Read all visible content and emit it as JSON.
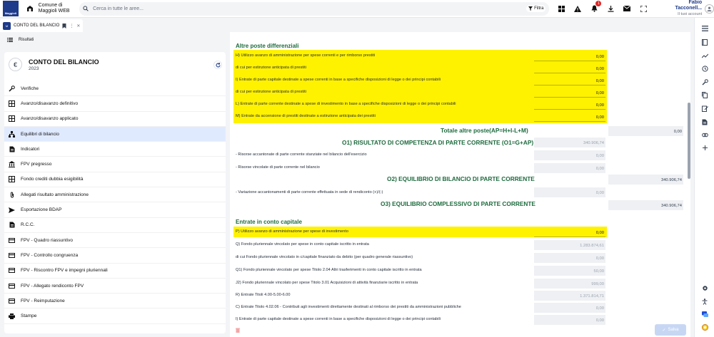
{
  "app": {
    "logo_text": "Maggioli",
    "brand_line1": "Comune di",
    "brand_line2": "Maggioli WEB",
    "search_placeholder": "Cerca in tutte le aree...",
    "filter_label": "Filtra",
    "notifications_count": "1",
    "user_name": "Fabio Tacconell...",
    "user_sub": "Il tuoi account"
  },
  "tab": {
    "icon_text": "M",
    "label": "CONTO DEL BILANCIO"
  },
  "results_label": "Risultati",
  "sidebar": {
    "title": "CONTO DEL BILANCIO",
    "year": "2023",
    "items": [
      {
        "label": "Verifiche",
        "icon": "wrench-icon"
      },
      {
        "label": "Avanzo/disavanzo definitivo",
        "icon": "grid-icon"
      },
      {
        "label": "Avanzo/disavanzo applicato",
        "icon": "grid-icon"
      },
      {
        "label": "Equilibri di bilancio",
        "icon": "sitemap-icon"
      },
      {
        "label": "Indicatori",
        "icon": "document-icon"
      },
      {
        "label": "FPV pregresso",
        "icon": "bank-icon"
      },
      {
        "label": "Fondo crediti dubbia esigibilità",
        "icon": "grid-icon"
      },
      {
        "label": "Allegati risultato amministrazione",
        "icon": "paperclip-icon"
      },
      {
        "label": "Esportazione BDAP",
        "icon": "send-icon"
      },
      {
        "label": "R.C.C.",
        "icon": "document-icon"
      },
      {
        "label": "FPV - Quadro riassuntivo",
        "icon": "card-icon"
      },
      {
        "label": "FPV - Controllo congruenza",
        "icon": "card-icon"
      },
      {
        "label": "FPV - Riscontro FPV e impegni pluriennali",
        "icon": "card-icon"
      },
      {
        "label": "FPV - Allegato rendiconto FPV",
        "icon": "card-icon"
      },
      {
        "label": "FPV - Reimputazione",
        "icon": "card-icon"
      },
      {
        "label": "Stampe",
        "icon": "printer-icon"
      }
    ]
  },
  "main": {
    "section1_title": "Altre poste differenziali",
    "rows1": [
      {
        "label": "H) Utilizzo avanzo di amministrazione per spese correnti e per rimborso prestiti",
        "value": "0,00"
      },
      {
        "label": "di cui per estinzione anticipata di prestiti",
        "value": "0,00"
      },
      {
        "label": "I) Entrate di parte capitale destinate a spese correnti in base a specifiche disposizioni di legge o dei principi contabili",
        "value": "0,00"
      },
      {
        "label": "di cui per estinzione anticipata di prestiti",
        "value": "0,00"
      },
      {
        "label": "L) Entrate di parte corrente destinate a spese di investimento in base a specifiche disposizioni di legge o dei principi contabili",
        "value": "0,00"
      },
      {
        "label": "M) Entrate da accensione di prestiti destinate a estinzione anticipata dei prestiti",
        "value": "0,00"
      }
    ],
    "total_label": "Totale altre poste(AP=H+I-L+M)",
    "total_value": "0,00",
    "o1_label": "O1) RISULTATO DI COMPETENZA DI PARTE CORRENTE (O1=G+AP)",
    "o1_value": "340.906,74",
    "o1_rows": [
      {
        "label": "- Risorse accantonate di parte corrente stanziate nel bilancio dell'esercizio",
        "value": "0,00"
      },
      {
        "label": "- Risorse vincolate di parte corrente nel bilancio",
        "value": "0,00"
      }
    ],
    "o2_label": "O2) EQUILIBRIO DI BILANCIO DI PARTE CORRENTE",
    "o2_value": "340.906,74",
    "o2_row": {
      "label": "- Variazione accantonamenti di parte corrente effettuata in sede di rendiconto (+)/(-)",
      "value": "0,00"
    },
    "o3_label": "O3) EQUILIBRIO COMPLESSIVO DI PARTE CORRENTE",
    "o3_value": "340.906,74",
    "section2_title": "Entrate in conto capitale",
    "p_row": {
      "label": "P) Utilizzo avanzo di amministrazione per spese di investimento",
      "value": "0,00"
    },
    "rows2": [
      {
        "label": "Q) Fondo pluriennale vincolato per spese in conto capitale iscritto in entrata",
        "value": "1.283.874,61"
      },
      {
        "label": "di cui Fondo pluriennale vincolato in c/capitale finanziato da debito (per quadro generale riassuntivo)",
        "value": "0,00"
      },
      {
        "label": "Q1) Fondo pluriennale vincolato per spese Titolo 2.04 Altri trasferimenti in conto capitale iscritto in entrata",
        "value": "50,00"
      },
      {
        "label": "J2) Fondo pluriennale vincolato per spese Titolo 3.01 Acquisizioni di attività finanziarie iscritto in entrata",
        "value": "999,00"
      },
      {
        "label": "R) Entrate Titoli 4.00-5.00-6.00",
        "value": "1.371.814,71"
      },
      {
        "label": "C) Entrate Titolo 4.02.06 - Contributi agli investimenti direttamente destinati al rimborso dei prestiti da amministrazioni pubbliche",
        "value": "0,00"
      },
      {
        "label": "I) Entrate di parte capitale destinate a spese correnti in base a specifiche disposizioni di legge o dei principi contabili",
        "value": "0,00"
      }
    ],
    "save_label": "Salva"
  }
}
